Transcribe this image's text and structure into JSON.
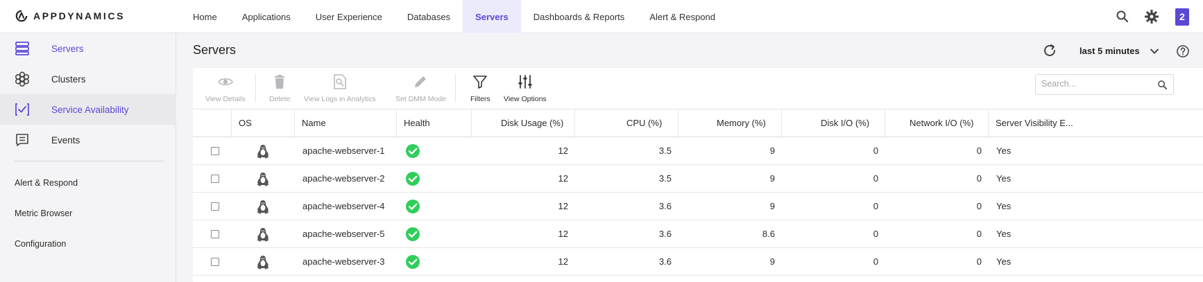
{
  "app": {
    "logo_text": "APPDYNAMICS"
  },
  "nav": {
    "items": [
      {
        "label": "Home",
        "active": false
      },
      {
        "label": "Applications",
        "active": false
      },
      {
        "label": "User Experience",
        "active": false
      },
      {
        "label": "Databases",
        "active": false
      },
      {
        "label": "Servers",
        "active": true
      },
      {
        "label": "Dashboards & Reports",
        "active": false
      },
      {
        "label": "Alert & Respond",
        "active": false
      }
    ],
    "notification_count": "2",
    "icons": [
      "search-icon",
      "gear-icon"
    ]
  },
  "sidebar": {
    "items": [
      {
        "label": "Servers",
        "icon": "servers-icon"
      },
      {
        "label": "Clusters",
        "icon": "clusters-icon"
      },
      {
        "label": "Service Availability",
        "icon": "service-availability-icon"
      },
      {
        "label": "Events",
        "icon": "events-icon"
      }
    ],
    "links": [
      "Alert & Respond",
      "Metric Browser",
      "Configuration"
    ]
  },
  "header": {
    "title": "Servers",
    "time_range": "last 5 minutes"
  },
  "toolbar": {
    "view_details": "View Details",
    "delete": "Delete",
    "view_logs": "View Logs in Analytics",
    "set_dmm": "Set DMM Mode",
    "filters": "Filters",
    "view_options": "View Options",
    "search_placeholder": "Search..."
  },
  "table": {
    "columns": [
      "OS",
      "Name",
      "Health",
      "Disk Usage (%)",
      "CPU (%)",
      "Memory (%)",
      "Disk I/O (%)",
      "Network I/O (%)",
      "Server Visibility E..."
    ],
    "rows": [
      {
        "os": "linux",
        "name": "apache-webserver-1",
        "health": "healthy",
        "disk": "12",
        "cpu": "3.5",
        "memory": "9",
        "disk_io": "0",
        "net_io": "0",
        "sv": "Yes"
      },
      {
        "os": "linux",
        "name": "apache-webserver-2",
        "health": "healthy",
        "disk": "12",
        "cpu": "3.5",
        "memory": "9",
        "disk_io": "0",
        "net_io": "0",
        "sv": "Yes"
      },
      {
        "os": "linux",
        "name": "apache-webserver-4",
        "health": "healthy",
        "disk": "12",
        "cpu": "3.6",
        "memory": "9",
        "disk_io": "0",
        "net_io": "0",
        "sv": "Yes"
      },
      {
        "os": "linux",
        "name": "apache-webserver-5",
        "health": "healthy",
        "disk": "12",
        "cpu": "3.6",
        "memory": "8.6",
        "disk_io": "0",
        "net_io": "0",
        "sv": "Yes"
      },
      {
        "os": "linux",
        "name": "apache-webserver-3",
        "health": "healthy",
        "disk": "12",
        "cpu": "3.6",
        "memory": "9",
        "disk_io": "0",
        "net_io": "0",
        "sv": "Yes"
      }
    ]
  },
  "colors": {
    "accent": "#5b48d6",
    "accent_bg": "#ecebfc",
    "healthy": "#2fce5a"
  }
}
